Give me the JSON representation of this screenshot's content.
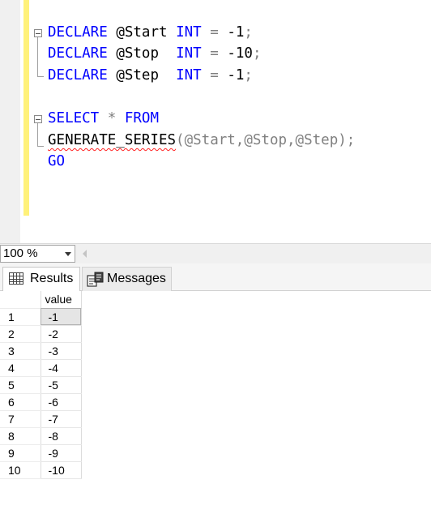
{
  "editor": {
    "lines": [
      {
        "kw1": "DECLARE",
        "var": "@Start",
        "type": "INT",
        "op": "=",
        "val": "-1",
        "end": ";"
      },
      {
        "kw1": "DECLARE",
        "var": "@Stop",
        "type": "INT",
        "op": "=",
        "val": "-10",
        "end": ";"
      },
      {
        "kw1": "DECLARE",
        "var": "@Step",
        "type": "INT",
        "op": "=",
        "val": "-1",
        "end": ";"
      }
    ],
    "select_kw": "SELECT",
    "star": "*",
    "from_kw": "FROM",
    "fn_name": "GENERATE_SERIES",
    "fn_args": "(@Start,@Stop,@Step);",
    "go_kw": "GO"
  },
  "zoom": {
    "value": "100 %"
  },
  "tabs": {
    "results": {
      "label": "Results",
      "icon": "grid-icon"
    },
    "messages": {
      "label": "Messages",
      "icon": "messages-icon"
    }
  },
  "grid": {
    "column_header": "value",
    "rows": [
      {
        "num": "1",
        "value": "-1"
      },
      {
        "num": "2",
        "value": "-2"
      },
      {
        "num": "3",
        "value": "-3"
      },
      {
        "num": "4",
        "value": "-4"
      },
      {
        "num": "5",
        "value": "-5"
      },
      {
        "num": "6",
        "value": "-6"
      },
      {
        "num": "7",
        "value": "-7"
      },
      {
        "num": "8",
        "value": "-8"
      },
      {
        "num": "9",
        "value": "-9"
      },
      {
        "num": "10",
        "value": "-10"
      }
    ]
  },
  "colors": {
    "keyword": "#0000ff",
    "change_bar": "#fff17a",
    "error_squiggle": "#ff2020"
  }
}
